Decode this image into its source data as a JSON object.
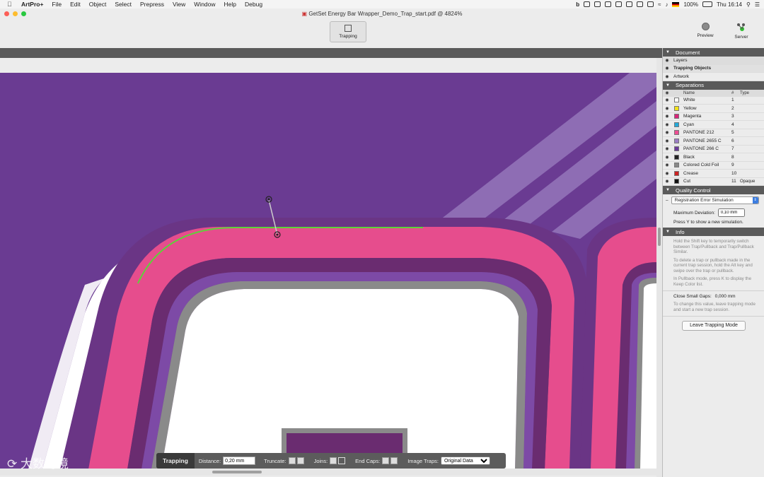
{
  "menubar": {
    "app": "ArtPro+",
    "items": [
      "File",
      "Edit",
      "Object",
      "Select",
      "Prepress",
      "View",
      "Window",
      "Help",
      "Debug"
    ],
    "battery": "100%",
    "clock": "Thu 16:14"
  },
  "window": {
    "title": "GetSet Energy Bar Wrapper_Demo_Trap_start.pdf @ 4824%"
  },
  "toolbar": {
    "trapping_label": "Trapping",
    "preview_label": "Preview",
    "server_label": "Server"
  },
  "trapbar": {
    "title": "Trapping",
    "distance_label": "Distance:",
    "distance_value": "0,20 mm",
    "truncate_label": "Truncate:",
    "joins_label": "Joins:",
    "endcaps_label": "End Caps:",
    "image_traps_label": "Image Traps:",
    "image_traps_value": "Original Data"
  },
  "panel": {
    "document_title": "Document",
    "layers_label": "Layers",
    "layers": [
      "Trapping Objects",
      "Artwork"
    ],
    "separations_title": "Separations",
    "sep_cols": {
      "name": "Name",
      "num": "#",
      "type": "Type"
    },
    "separations": [
      {
        "name": "White",
        "num": "1",
        "type": "",
        "color": "#ffffff"
      },
      {
        "name": "Yellow",
        "num": "2",
        "type": "",
        "color": "#f2e21c"
      },
      {
        "name": "Magenta",
        "num": "3",
        "type": "",
        "color": "#d9247a"
      },
      {
        "name": "Cyan",
        "num": "4",
        "type": "",
        "color": "#24a9d9"
      },
      {
        "name": "PANTONE 212",
        "num": "5",
        "type": "",
        "color": "#ee4d93"
      },
      {
        "name": "PANTONE 2655 C",
        "num": "6",
        "type": "",
        "color": "#9b7fc4"
      },
      {
        "name": "PANTONE 266 C",
        "num": "7",
        "type": "",
        "color": "#6b3a9a"
      },
      {
        "name": "Black",
        "num": "8",
        "type": "",
        "color": "#222222"
      },
      {
        "name": "Colored Cold Foil",
        "num": "9",
        "type": "",
        "color": "#888888"
      },
      {
        "name": "Crease",
        "num": "10",
        "type": "",
        "color": "#cc2222"
      },
      {
        "name": "Cut",
        "num": "11",
        "type": "Opaque",
        "color": "#111111"
      }
    ],
    "qc_title": "Quality Control",
    "qc_select": "Registration Error Simulation",
    "max_dev_label": "Maximum Deviation:",
    "max_dev_value": "0,10 mm",
    "qc_hint": "Press Y to show a new simulation.",
    "info_title": "Info",
    "info_1": "Hold the Shift key to temporarily switch between Trap/Pullback and Trap/Pullback Similar.",
    "info_2": "To delete a trap or pullback made in the current trap session, hold the Alt key and swipe over the trap or pullback.",
    "info_3": "In Pullback mode, press K to display the Keep Color list.",
    "close_gaps_label": "Close Small Gaps:",
    "close_gaps_value": "0,000 mm",
    "info_4": "To change this value, leave trapping mode and start a new trap session.",
    "leave_button": "Leave Trapping Mode"
  },
  "watermark": "大数跨境",
  "colors": {
    "purple_bg": "#6b3a93",
    "pink": "#e64d8d",
    "dark_purple": "#5a2a6e",
    "trap_line": "#5fd13a"
  }
}
